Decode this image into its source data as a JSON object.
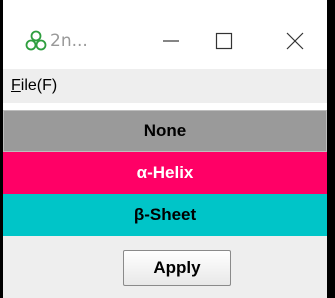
{
  "window": {
    "title": "2n...",
    "icon": "clover-icon",
    "controls": [
      "minimize-icon",
      "maximize-icon",
      "close-icon"
    ]
  },
  "menu": {
    "file_mnemonic": "F",
    "file_rest": "ile(F)"
  },
  "options": [
    {
      "label": "None",
      "color": "#9a9a9a"
    },
    {
      "label": "α-Helix",
      "color": "#ff0066"
    },
    {
      "label": "β-Sheet",
      "color": "#00c5c8"
    }
  ],
  "footer": {
    "apply_label": "Apply"
  }
}
